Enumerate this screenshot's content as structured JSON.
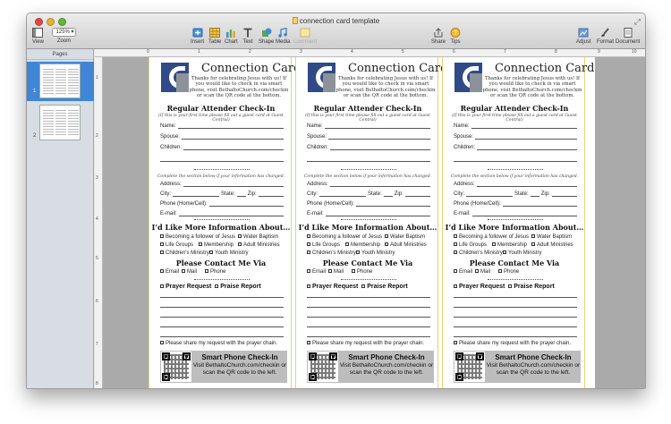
{
  "window": {
    "title": "connection card template"
  },
  "toolbar": {
    "view": "View",
    "zoom_value": "125%",
    "zoom": "Zoom",
    "insert": "Insert",
    "table": "Table",
    "chart": "Chart",
    "text": "Text",
    "shape": "Shape",
    "media": "Media",
    "comment": "Comment",
    "share": "Share",
    "tips": "Tips",
    "adjust": "Adjust",
    "format": "Format",
    "document": "Document"
  },
  "sidebar": {
    "header": "Pages",
    "pages": [
      "1",
      "2"
    ]
  },
  "ruler": {
    "top": [
      "0",
      "1",
      "2",
      "3",
      "4",
      "5",
      "6",
      "7",
      "8",
      "9",
      "10"
    ],
    "left": [
      "1",
      "2",
      "3",
      "4",
      "5",
      "6",
      "7",
      "8"
    ]
  },
  "card": {
    "title": "Connection Card",
    "intro": "Thanks for celebrating Jesus with us! If you would like to check in via smart phone, visit BethaltoChurch.com/checkin or scan the QR code at the bottom.",
    "checkin_heading": "Regular Attender Check-In",
    "checkin_note": "(If this is your first time please fill out a guest card at Guest Central)",
    "name": "Name:",
    "spouse": "Spouse:",
    "children": "Children:",
    "change_note": "Complete the section below if your information has changed.",
    "address": "Address:",
    "city": "City:",
    "state": "State:",
    "zip": "Zip:",
    "phone": "Phone (Home/Cell):",
    "email": "E-mail:",
    "info_heading": "I’d Like More Information About…",
    "opt_follower": "Becoming a follower of Jesus",
    "opt_baptism": "Water Baptism",
    "opt_life": "Life Groups",
    "opt_membership": "Membership",
    "opt_adult": "Adult Ministries",
    "opt_children": "Children's Ministry",
    "opt_youth": "Youth Ministry",
    "contact_heading": "Please Contact Me Via",
    "c_email": "Email",
    "c_mail": "Mail",
    "c_phone": "Phone",
    "prayer": "Prayer Request",
    "praise": "Praise Report",
    "share": "Please share my request with the prayer chain.",
    "smart_title": "Smart Phone Check-In",
    "smart_text": "Visit BethaltoChurch.com/checkin or scan the QR code to the left."
  }
}
